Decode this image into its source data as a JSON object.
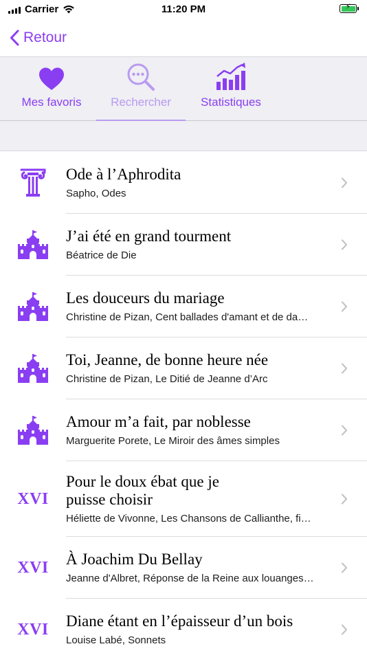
{
  "status_bar": {
    "carrier": "Carrier",
    "time": "11:20 PM",
    "battery_charging": true
  },
  "nav": {
    "back_label": "Retour"
  },
  "colors": {
    "accent": "#8a3ef2",
    "accent_light": "#b99af0",
    "battery": "#34c759"
  },
  "tabs": [
    {
      "label": "Mes favoris",
      "icon": "heart-icon",
      "selected": false
    },
    {
      "label": "Rechercher",
      "icon": "search-icon",
      "selected": true
    },
    {
      "label": "Statistiques",
      "icon": "stats-chart-icon",
      "selected": false
    }
  ],
  "poems": [
    {
      "title": "Ode à l’Aphrodita",
      "subtitle": "Sapho, Odes",
      "icon": "ionic-column-icon"
    },
    {
      "title": "J’ai été en grand tourment",
      "subtitle": "Béatrice de Die",
      "icon": "castle-icon"
    },
    {
      "title": "Les douceurs du mariage",
      "subtitle": "Christine de Pizan, Cent ballades d'amant et de da…",
      "icon": "castle-icon"
    },
    {
      "title": "Toi, Jeanne, de bonne heure née",
      "subtitle": "Christine de Pizan, Le Ditié de Jeanne d’Arc",
      "icon": "castle-icon"
    },
    {
      "title": "Amour m’a fait, par noblesse",
      "subtitle": "Marguerite Porete, Le Miroir des âmes simples",
      "icon": "castle-icon"
    },
    {
      "title": "Pour le doux ébat que je puisse choisir",
      "subtitle": "Héliette de Vivonne, Les Chansons de Callianthe, fi…",
      "icon": "century-xvi-icon",
      "century": "XVI"
    },
    {
      "title": "À Joachim Du Bellay",
      "subtitle": "Jeanne d'Albret, Réponse de la Reine aux louanges…",
      "icon": "century-xvi-icon",
      "century": "XVI"
    },
    {
      "title": "Diane étant en l’épaisseur d’un bois",
      "subtitle": "Louise Labé, Sonnets",
      "icon": "century-xvi-icon",
      "century": "XVI"
    }
  ]
}
